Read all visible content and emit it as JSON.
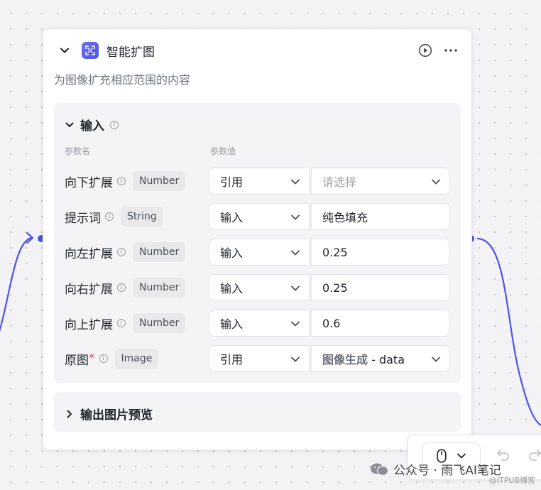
{
  "node": {
    "title": "智能扩图",
    "description": "为图像扩充相应范围的内容",
    "icon": "expand-image-icon",
    "accent": "#4d53e8"
  },
  "inputs": {
    "title": "输入",
    "col_name": "参数名",
    "col_value": "参数值",
    "rows": [
      {
        "name": "向下扩展",
        "type": "Number",
        "mode": "引用",
        "value": "请选择",
        "required": false
      },
      {
        "name": "提示词",
        "type": "String",
        "mode": "输入",
        "value": "纯色填充",
        "required": false
      },
      {
        "name": "向左扩展",
        "type": "Number",
        "mode": "输入",
        "value": "0.25",
        "required": false
      },
      {
        "name": "向右扩展",
        "type": "Number",
        "mode": "输入",
        "value": "0.25",
        "required": false
      },
      {
        "name": "向上扩展",
        "type": "Number",
        "mode": "输入",
        "value": "0.6",
        "required": false
      },
      {
        "name": "原图",
        "type": "Image",
        "mode": "引用",
        "value_strong": "图像生成",
        "value_rest": " - data",
        "required": true,
        "required_mark": "*"
      }
    ]
  },
  "outputs": {
    "title": "输出图片预览"
  },
  "watermark": {
    "main": "公众号 · 雨飞AI笔记",
    "sub": "@ITPUB博客"
  }
}
